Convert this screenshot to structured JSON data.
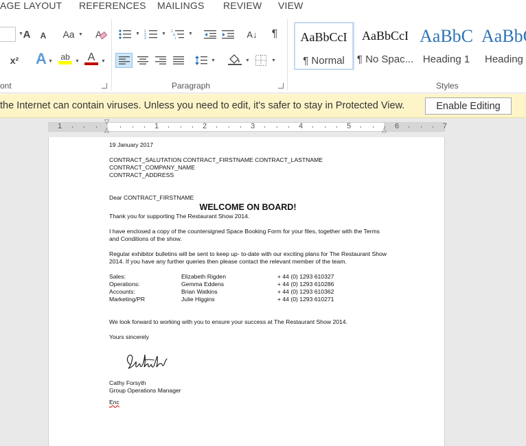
{
  "ribbon": {
    "tabs": [
      "AGE LAYOUT",
      "REFERENCES",
      "MAILINGS",
      "REVIEW",
      "VIEW"
    ],
    "groups": {
      "font": "ont",
      "paragraph": "Paragraph",
      "styles": "Styles"
    },
    "font_buttons": {
      "grow": "A",
      "shrink": "A",
      "change_case": "Aa",
      "superscript": "x²",
      "highlight": "ab",
      "font_color": "A",
      "text_effects": "A"
    },
    "paragraph_buttons": {
      "show_marks": "¶",
      "sort": "A↓"
    },
    "styles": [
      {
        "sample": "AaBbCcI",
        "name": "¶ Normal",
        "selected": true
      },
      {
        "sample": "AaBbCcI",
        "name": "¶ No Spac...",
        "selected": false
      },
      {
        "sample": "AaBbC",
        "name": "Heading 1",
        "selected": false
      },
      {
        "sample": "AaBbC",
        "name": "Heading",
        "selected": false
      }
    ],
    "colors": {
      "highlight": "#ffff00",
      "font_color": "#c00000",
      "heading": "#2e74b5"
    }
  },
  "protected_view": {
    "message": "the Internet can contain viruses. Unless you need to edit, it's safer to stay in Protected View.",
    "button": "Enable Editing"
  },
  "ruler": {
    "numbers": [
      "1",
      "1",
      "2",
      "3",
      "4",
      "5",
      "6",
      "7"
    ]
  },
  "document": {
    "date": "19 January 2017",
    "address": [
      "CONTRACT_SALUTATION  CONTRACT_FIRSTNAME CONTRACT_LASTNAME",
      "CONTRACT_COMPANY_NAME",
      "CONTRACT_ADDRESS"
    ],
    "greeting": "Dear CONTRACT_FIRSTNAME",
    "heading": "WELCOME ON BOARD!",
    "para1": "Thank you for supporting The Restaurant Show 2014.",
    "para2": "I have enclosed a copy of the countersigned Space Booking Form for your files, together with the Terms and Conditions of the show.",
    "para3": "Regular exhibitor bulletins will be sent to keep up- to-date with our exciting plans for The Restaurant Show 2014. If you have any further queries then please contact the relevant member of the team.",
    "team": [
      {
        "role": "Sales:",
        "name": "Elizabeth Rigden",
        "phone": "+ 44 (0) 1293 610327"
      },
      {
        "role": "Operations:",
        "name": "Gemma Eddens",
        "phone": "+ 44 (0) 1293 610286"
      },
      {
        "role": "Accounts:",
        "name": "Brian Watkins",
        "phone": "+ 44 (0) 1293 610362"
      },
      {
        "role": "Marketing/PR",
        "name": "Julie Higgins",
        "phone": "+ 44 (0) 1293 610271"
      }
    ],
    "closing_line": "We look forward to working with you to ensure your success at The Restaurant Show 2014.",
    "sign_off": "Yours sincerely",
    "signature_text": "Cathy Forsyth",
    "signer_name": "Cathy Forsyth",
    "signer_title": "Group Operations Manager",
    "enc": "Enc"
  }
}
